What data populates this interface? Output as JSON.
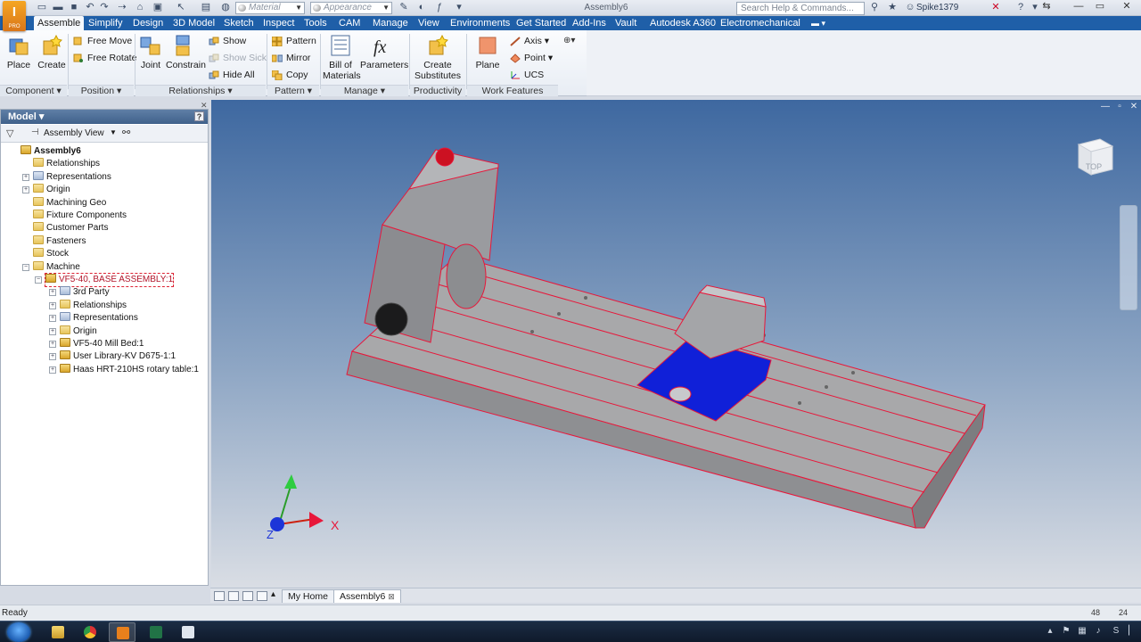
{
  "app": {
    "logo_letter": "I",
    "logo_sub": "PRO",
    "document_title": "Assembly6",
    "material_placeholder": "Material",
    "appearance_placeholder": "Appearance",
    "search_placeholder": "Search Help & Commands...",
    "user_name": "Spike1379"
  },
  "ribbon_tabs": [
    "Assemble",
    "Simplify",
    "Design",
    "3D Model",
    "Sketch",
    "Inspect",
    "Tools",
    "CAM",
    "Manage",
    "View",
    "Environments",
    "Get Started",
    "Add-Ins",
    "Vault",
    "Autodesk A360",
    "Electromechanical"
  ],
  "ribbon": {
    "component": {
      "label": "Component",
      "place": "Place",
      "create": "Create"
    },
    "position": {
      "label": "Position",
      "free_move": "Free Move",
      "free_rotate": "Free Rotate"
    },
    "relationships": {
      "label": "Relationships",
      "joint": "Joint",
      "constrain": "Constrain",
      "show": "Show",
      "show_sick": "Show Sick",
      "hide_all": "Hide All"
    },
    "pattern": {
      "label": "Pattern",
      "pattern": "Pattern",
      "mirror": "Mirror",
      "copy": "Copy"
    },
    "manage": {
      "label": "Manage",
      "bom_line1": "Bill of",
      "bom_line2": "Materials",
      "parameters": "Parameters"
    },
    "productivity": {
      "label": "Productivity",
      "create_line1": "Create",
      "create_line2": "Substitutes"
    },
    "work_features": {
      "label": "Work Features",
      "plane": "Plane",
      "axis": "Axis",
      "point": "Point",
      "ucs": "UCS"
    }
  },
  "browser": {
    "title": "Model",
    "view_label": "Assembly View",
    "tree": [
      {
        "label": "Assembly6",
        "level": 0,
        "icon": "asm",
        "expander": ""
      },
      {
        "label": "Relationships",
        "level": 1,
        "icon": "folder",
        "expander": ""
      },
      {
        "label": "Representations",
        "level": 1,
        "icon": "blue",
        "expander": "+"
      },
      {
        "label": "Origin",
        "level": 1,
        "icon": "folder",
        "expander": "+"
      },
      {
        "label": "Machining Geo",
        "level": 1,
        "icon": "folder",
        "expander": ""
      },
      {
        "label": "Fixture Components",
        "level": 1,
        "icon": "folder",
        "expander": ""
      },
      {
        "label": "Customer Parts",
        "level": 1,
        "icon": "folder",
        "expander": ""
      },
      {
        "label": "Fasteners",
        "level": 1,
        "icon": "folder",
        "expander": ""
      },
      {
        "label": "Stock",
        "level": 1,
        "icon": "folder",
        "expander": ""
      },
      {
        "label": "Machine",
        "level": 1,
        "icon": "folder",
        "expander": "−"
      },
      {
        "label": "VF5-40, BASE ASSEMBLY:1",
        "level": 2,
        "icon": "asm",
        "expander": "−",
        "selected": true
      },
      {
        "label": "3rd Party",
        "level": 3,
        "icon": "blue",
        "expander": "+"
      },
      {
        "label": "Relationships",
        "level": 3,
        "icon": "folder",
        "expander": "+"
      },
      {
        "label": "Representations",
        "level": 3,
        "icon": "blue",
        "expander": "+"
      },
      {
        "label": "Origin",
        "level": 3,
        "icon": "folder",
        "expander": "+"
      },
      {
        "label": "VF5-40 Mill Bed:1",
        "level": 3,
        "icon": "asm",
        "expander": "+"
      },
      {
        "label": "User Library-KV D675-1:1",
        "level": 3,
        "icon": "asm",
        "expander": "+"
      },
      {
        "label": "Haas HRT-210HS rotary table:1",
        "level": 3,
        "icon": "asm",
        "expander": "+"
      }
    ]
  },
  "viewport": {
    "viewcube_label": "TOP",
    "axis_x": "X",
    "axis_z": "Z"
  },
  "doc_tabs": {
    "home": "My Home",
    "active": "Assembly6"
  },
  "status": {
    "text": "Ready",
    "num1": "48",
    "num2": "24"
  },
  "colors": {
    "ribbon_tab_bg": "#1f5fa8",
    "highlight_red": "#e8173a",
    "highlight_blue": "#1020d8"
  }
}
